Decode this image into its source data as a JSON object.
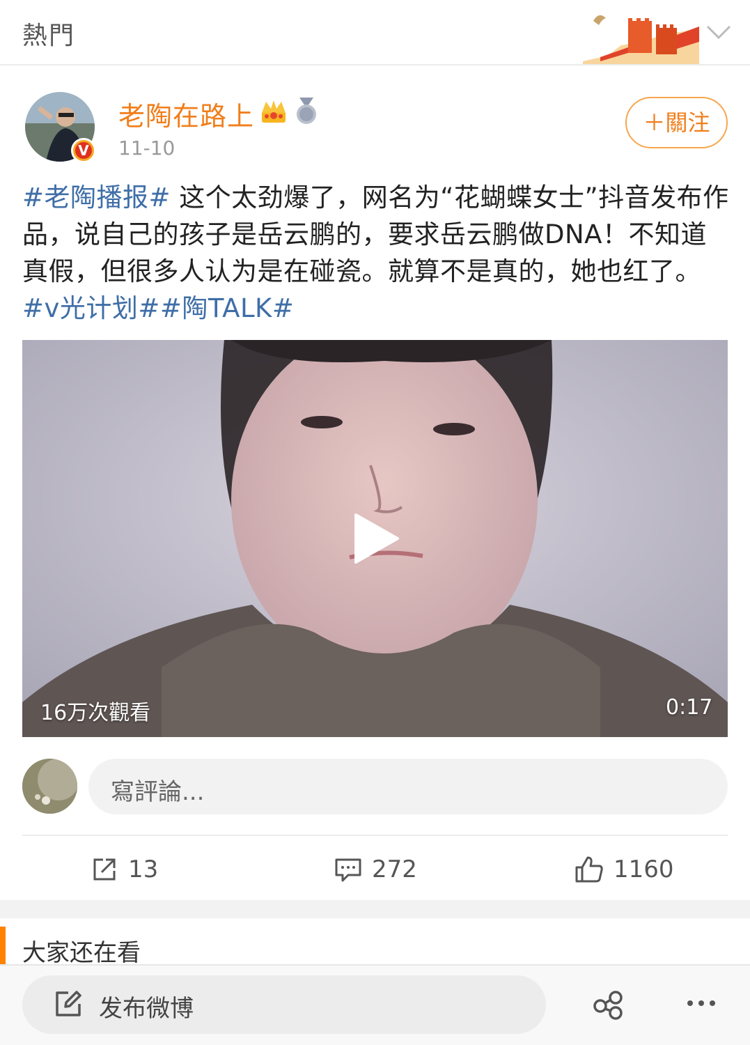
{
  "header": {
    "title": "熱門",
    "chevron_icon": "chevron-down-icon",
    "banner_icon": "great-wall-banner-icon"
  },
  "post": {
    "author": "老陶在路上",
    "author_color": "#f07e1b",
    "badges": [
      "crown-icon",
      "medal-icon"
    ],
    "verified_mark": "V",
    "time": "11-10",
    "follow_label": "＋關注",
    "text_segments": [
      {
        "text": "#老陶播报#",
        "type": "tag"
      },
      {
        "text": " 这个太劲爆了，网名为“花蝴蝶女士”抖音发布作品，说自己的孩子是岳云鹏的，要求岳云鹏做DNA！不知道真假，但很多人认为是在碰瓷。就算不是真的，她也红了。",
        "type": "plain"
      },
      {
        "text": "#v光计划#",
        "type": "tag"
      },
      {
        "text": "#陶TALK#",
        "type": "tag"
      }
    ],
    "tag_color": "#3f6ea7",
    "video": {
      "views": "16万次觀看",
      "duration": "0:17",
      "play_icon": "play-icon"
    }
  },
  "comment": {
    "placeholder": "寫評論..."
  },
  "actions": {
    "repost": {
      "icon": "share-out-icon",
      "count": "13"
    },
    "comment": {
      "icon": "comment-icon",
      "count": "272"
    },
    "like": {
      "icon": "thumbs-up-icon",
      "count": "1160"
    }
  },
  "section": {
    "title": "大家还在看",
    "accent": "#ff8200"
  },
  "bottom": {
    "compose_label": "发布微博",
    "compose_icon": "edit-icon",
    "share_icon": "share-nodes-icon",
    "more_icon": "more-dots-icon"
  }
}
